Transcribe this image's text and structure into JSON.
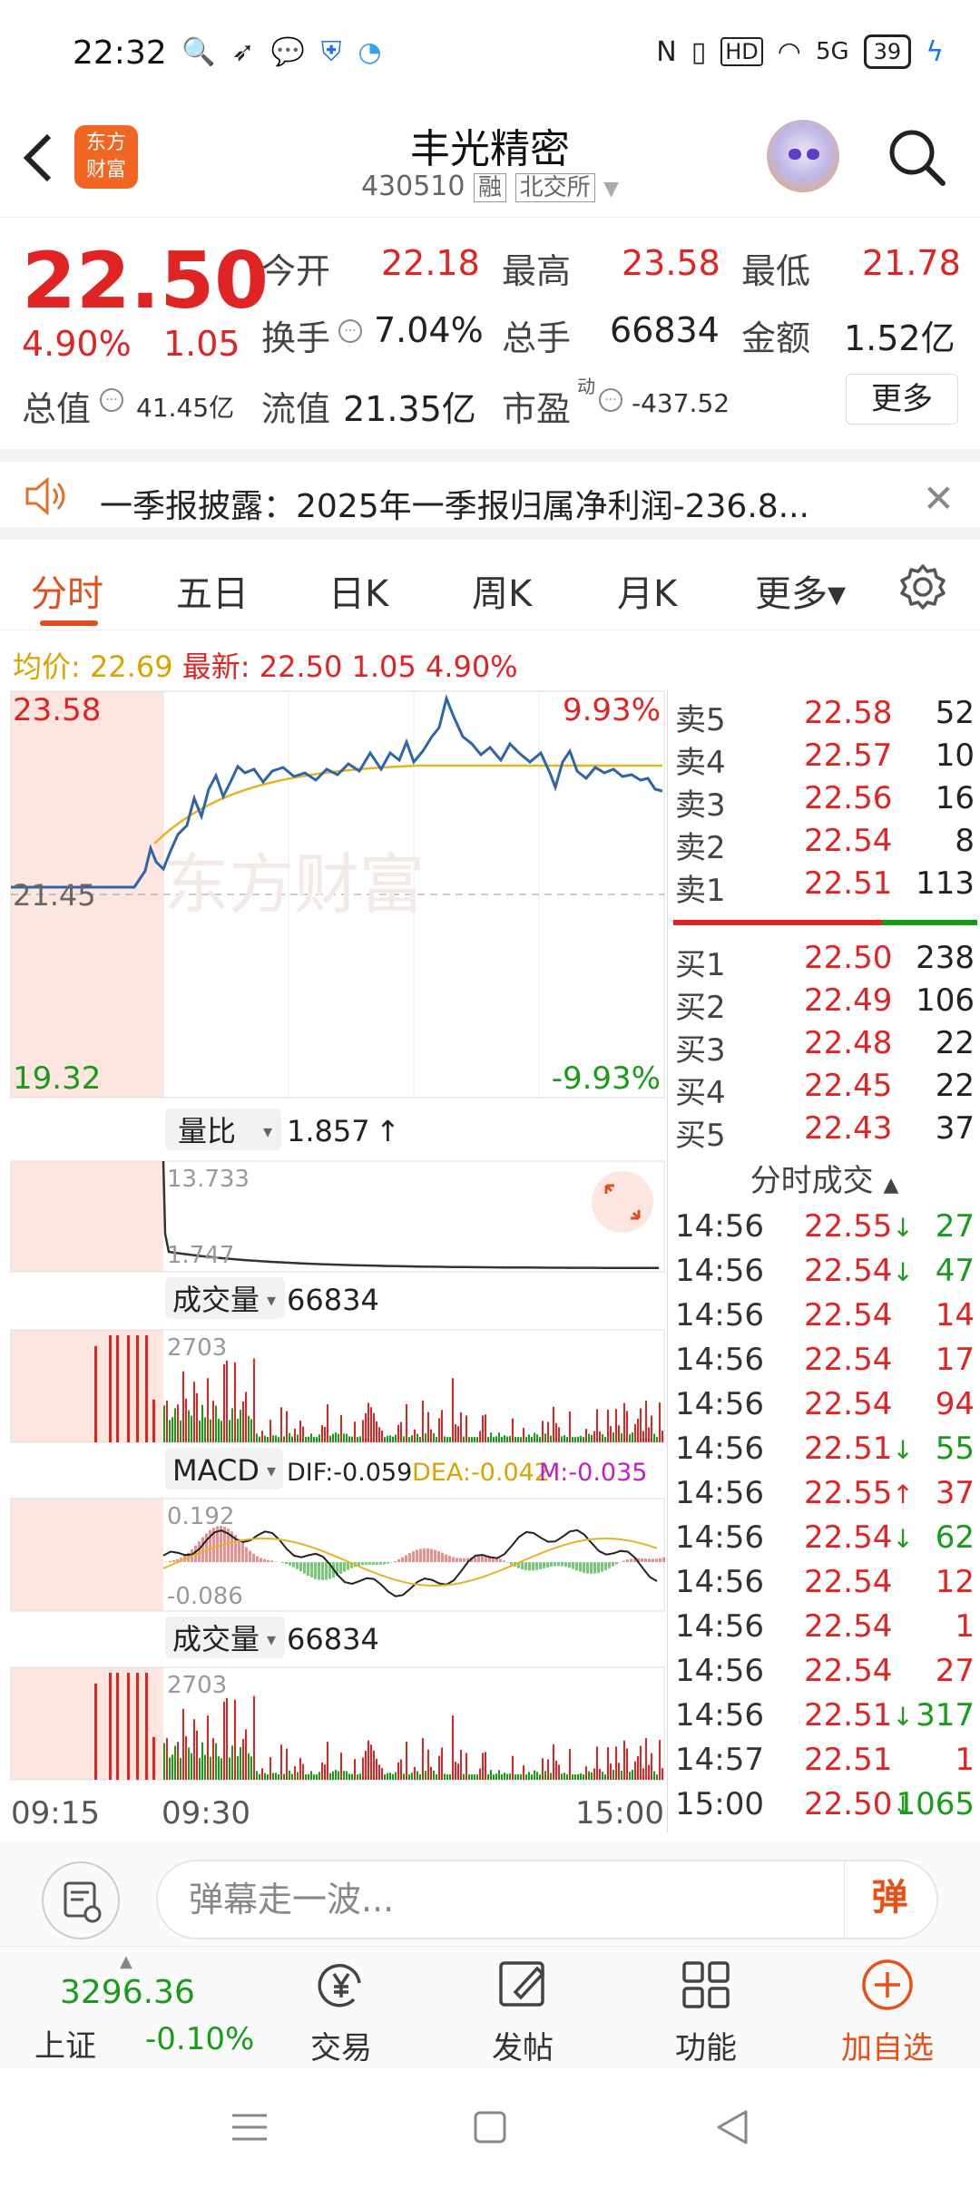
{
  "status_bar": {
    "time": "22:32",
    "battery": "39",
    "network": "5G"
  },
  "header": {
    "back": "‹",
    "logo_line1": "东方",
    "logo_line2": "财富",
    "title": "丰光精密",
    "code": "430510",
    "tag_rong": "融",
    "tag_exchange": "北交所"
  },
  "quote": {
    "price": "22.50",
    "change_pct": "4.90%",
    "change_abs": "1.05",
    "open_label": "今开",
    "open": "22.18",
    "high_label": "最高",
    "high": "23.58",
    "low_label": "最低",
    "low": "21.78",
    "turnover_label": "换手",
    "turnover": "7.04%",
    "volume_label": "总手",
    "volume": "66834",
    "amount_label": "金额",
    "amount": "1.52亿",
    "mktcap_label": "总值",
    "mktcap": "41.45亿",
    "float_label": "流值",
    "float": "21.35亿",
    "pe_label": "市盈",
    "pe_sup": "动",
    "pe": "-437.52",
    "more": "更多"
  },
  "notice": {
    "text": "一季报披露：2025年一季报归属净利润-236.8..."
  },
  "tabs": [
    {
      "label": "分时"
    },
    {
      "label": "五日"
    },
    {
      "label": "日K"
    },
    {
      "label": "周K"
    },
    {
      "label": "月K"
    },
    {
      "label": "更多▾"
    }
  ],
  "avg_line": {
    "avg_label": "均价:",
    "avg": "22.69",
    "latest_label": "最新:",
    "latest": "22.50",
    "chg": "1.05",
    "pct": "4.90%"
  },
  "intraday": {
    "top_price": "23.58",
    "mid_price": "21.45",
    "bottom_price": "19.32",
    "top_pct": "9.93%",
    "bottom_pct": "-9.93%",
    "watermark": "东方财富"
  },
  "indicators": {
    "ratio_label": "量比",
    "ratio_value": "1.857",
    "ratio_top": "13.733",
    "ratio_bottom": "1.747",
    "vol_label": "成交量",
    "vol_value": "66834",
    "vol_top": "2703",
    "macd_label": "MACD",
    "dif": "DIF:-0.059",
    "dea": "DEA:-0.042",
    "m": "M:-0.035",
    "macd_top": "0.192",
    "macd_bottom": "-0.086",
    "vol2_label": "成交量",
    "vol2_value": "66834",
    "vol2_top": "2703"
  },
  "time_axis": {
    "start": "09:15",
    "open": "09:30",
    "end": "15:00"
  },
  "order_book": {
    "asks": [
      {
        "label": "卖5",
        "price": "22.58",
        "vol": "52"
      },
      {
        "label": "卖4",
        "price": "22.57",
        "vol": "10"
      },
      {
        "label": "卖3",
        "price": "22.56",
        "vol": "16"
      },
      {
        "label": "卖2",
        "price": "22.54",
        "vol": "8"
      },
      {
        "label": "卖1",
        "price": "22.51",
        "vol": "113"
      }
    ],
    "bids": [
      {
        "label": "买1",
        "price": "22.50",
        "vol": "238"
      },
      {
        "label": "买2",
        "price": "22.49",
        "vol": "106"
      },
      {
        "label": "买3",
        "price": "22.48",
        "vol": "22"
      },
      {
        "label": "买4",
        "price": "22.45",
        "vol": "22"
      },
      {
        "label": "买5",
        "price": "22.43",
        "vol": "37"
      }
    ]
  },
  "trades": {
    "title": "分时成交",
    "rows": [
      {
        "time": "14:56",
        "price": "22.55",
        "dir": "↓",
        "vol": "27",
        "vc": "green"
      },
      {
        "time": "14:56",
        "price": "22.54",
        "dir": "↓",
        "vol": "47",
        "vc": "green"
      },
      {
        "time": "14:56",
        "price": "22.54",
        "dir": "",
        "vol": "14",
        "vc": "red"
      },
      {
        "time": "14:56",
        "price": "22.54",
        "dir": "",
        "vol": "17",
        "vc": "red"
      },
      {
        "time": "14:56",
        "price": "22.54",
        "dir": "",
        "vol": "94",
        "vc": "red"
      },
      {
        "time": "14:56",
        "price": "22.51",
        "dir": "↓",
        "vol": "55",
        "vc": "green"
      },
      {
        "time": "14:56",
        "price": "22.55",
        "dir": "↑",
        "vol": "37",
        "vc": "red"
      },
      {
        "time": "14:56",
        "price": "22.54",
        "dir": "↓",
        "vol": "62",
        "vc": "green"
      },
      {
        "time": "14:56",
        "price": "22.54",
        "dir": "",
        "vol": "12",
        "vc": "red"
      },
      {
        "time": "14:56",
        "price": "22.54",
        "dir": "",
        "vol": "1",
        "vc": "red"
      },
      {
        "time": "14:56",
        "price": "22.54",
        "dir": "",
        "vol": "27",
        "vc": "red"
      },
      {
        "time": "14:56",
        "price": "22.51",
        "dir": "↓",
        "vol": "317",
        "vc": "green"
      },
      {
        "time": "14:57",
        "price": "22.51",
        "dir": "",
        "vol": "1",
        "vc": "red"
      },
      {
        "time": "15:00",
        "price": "22.50",
        "dir": "↓",
        "vol": "1065",
        "vc": "green"
      }
    ]
  },
  "comment": {
    "placeholder": "弹幕走一波...",
    "danmu": "弹"
  },
  "bottom_nav": {
    "index_value": "3296.36",
    "index_name": "上证",
    "index_change": "-0.10%",
    "trade": "交易",
    "post": "发帖",
    "functions": "功能",
    "watchlist": "加自选"
  },
  "colors": {
    "up": "#e02424",
    "down": "#1a9c1a",
    "accent": "#e0501a",
    "avg": "#e6b422",
    "line": "#2f64a8"
  }
}
